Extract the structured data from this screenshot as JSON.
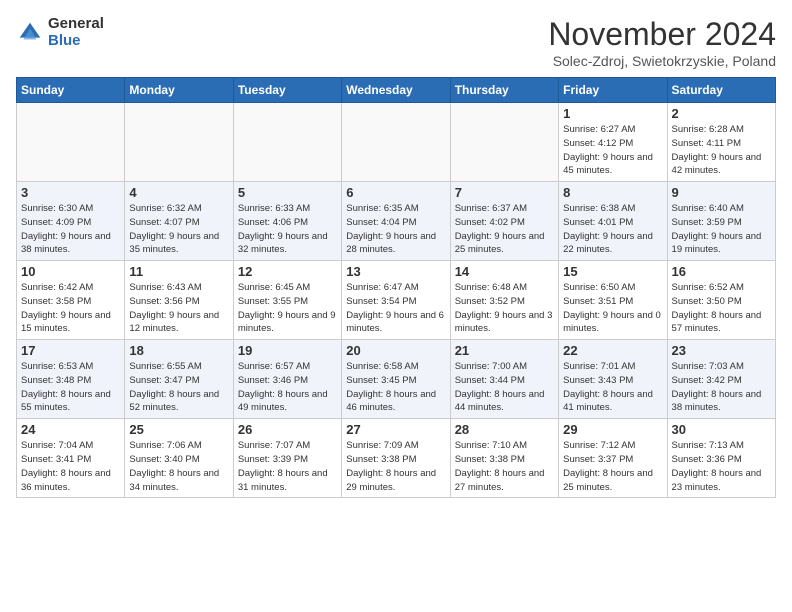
{
  "logo": {
    "general": "General",
    "blue": "Blue"
  },
  "title": "November 2024",
  "subtitle": "Solec-Zdroj, Swietokrzyskie, Poland",
  "days_of_week": [
    "Sunday",
    "Monday",
    "Tuesday",
    "Wednesday",
    "Thursday",
    "Friday",
    "Saturday"
  ],
  "weeks": [
    [
      {
        "day": "",
        "empty": true
      },
      {
        "day": "",
        "empty": true
      },
      {
        "day": "",
        "empty": true
      },
      {
        "day": "",
        "empty": true
      },
      {
        "day": "",
        "empty": true
      },
      {
        "day": "1",
        "sunrise": "6:27 AM",
        "sunset": "4:12 PM",
        "daylight": "Daylight: 9 hours and 45 minutes."
      },
      {
        "day": "2",
        "sunrise": "6:28 AM",
        "sunset": "4:11 PM",
        "daylight": "Daylight: 9 hours and 42 minutes."
      }
    ],
    [
      {
        "day": "3",
        "sunrise": "6:30 AM",
        "sunset": "4:09 PM",
        "daylight": "Daylight: 9 hours and 38 minutes."
      },
      {
        "day": "4",
        "sunrise": "6:32 AM",
        "sunset": "4:07 PM",
        "daylight": "Daylight: 9 hours and 35 minutes."
      },
      {
        "day": "5",
        "sunrise": "6:33 AM",
        "sunset": "4:06 PM",
        "daylight": "Daylight: 9 hours and 32 minutes."
      },
      {
        "day": "6",
        "sunrise": "6:35 AM",
        "sunset": "4:04 PM",
        "daylight": "Daylight: 9 hours and 28 minutes."
      },
      {
        "day": "7",
        "sunrise": "6:37 AM",
        "sunset": "4:02 PM",
        "daylight": "Daylight: 9 hours and 25 minutes."
      },
      {
        "day": "8",
        "sunrise": "6:38 AM",
        "sunset": "4:01 PM",
        "daylight": "Daylight: 9 hours and 22 minutes."
      },
      {
        "day": "9",
        "sunrise": "6:40 AM",
        "sunset": "3:59 PM",
        "daylight": "Daylight: 9 hours and 19 minutes."
      }
    ],
    [
      {
        "day": "10",
        "sunrise": "6:42 AM",
        "sunset": "3:58 PM",
        "daylight": "Daylight: 9 hours and 15 minutes."
      },
      {
        "day": "11",
        "sunrise": "6:43 AM",
        "sunset": "3:56 PM",
        "daylight": "Daylight: 9 hours and 12 minutes."
      },
      {
        "day": "12",
        "sunrise": "6:45 AM",
        "sunset": "3:55 PM",
        "daylight": "Daylight: 9 hours and 9 minutes."
      },
      {
        "day": "13",
        "sunrise": "6:47 AM",
        "sunset": "3:54 PM",
        "daylight": "Daylight: 9 hours and 6 minutes."
      },
      {
        "day": "14",
        "sunrise": "6:48 AM",
        "sunset": "3:52 PM",
        "daylight": "Daylight: 9 hours and 3 minutes."
      },
      {
        "day": "15",
        "sunrise": "6:50 AM",
        "sunset": "3:51 PM",
        "daylight": "Daylight: 9 hours and 0 minutes."
      },
      {
        "day": "16",
        "sunrise": "6:52 AM",
        "sunset": "3:50 PM",
        "daylight": "Daylight: 8 hours and 57 minutes."
      }
    ],
    [
      {
        "day": "17",
        "sunrise": "6:53 AM",
        "sunset": "3:48 PM",
        "daylight": "Daylight: 8 hours and 55 minutes."
      },
      {
        "day": "18",
        "sunrise": "6:55 AM",
        "sunset": "3:47 PM",
        "daylight": "Daylight: 8 hours and 52 minutes."
      },
      {
        "day": "19",
        "sunrise": "6:57 AM",
        "sunset": "3:46 PM",
        "daylight": "Daylight: 8 hours and 49 minutes."
      },
      {
        "day": "20",
        "sunrise": "6:58 AM",
        "sunset": "3:45 PM",
        "daylight": "Daylight: 8 hours and 46 minutes."
      },
      {
        "day": "21",
        "sunrise": "7:00 AM",
        "sunset": "3:44 PM",
        "daylight": "Daylight: 8 hours and 44 minutes."
      },
      {
        "day": "22",
        "sunrise": "7:01 AM",
        "sunset": "3:43 PM",
        "daylight": "Daylight: 8 hours and 41 minutes."
      },
      {
        "day": "23",
        "sunrise": "7:03 AM",
        "sunset": "3:42 PM",
        "daylight": "Daylight: 8 hours and 38 minutes."
      }
    ],
    [
      {
        "day": "24",
        "sunrise": "7:04 AM",
        "sunset": "3:41 PM",
        "daylight": "Daylight: 8 hours and 36 minutes."
      },
      {
        "day": "25",
        "sunrise": "7:06 AM",
        "sunset": "3:40 PM",
        "daylight": "Daylight: 8 hours and 34 minutes."
      },
      {
        "day": "26",
        "sunrise": "7:07 AM",
        "sunset": "3:39 PM",
        "daylight": "Daylight: 8 hours and 31 minutes."
      },
      {
        "day": "27",
        "sunrise": "7:09 AM",
        "sunset": "3:38 PM",
        "daylight": "Daylight: 8 hours and 29 minutes."
      },
      {
        "day": "28",
        "sunrise": "7:10 AM",
        "sunset": "3:38 PM",
        "daylight": "Daylight: 8 hours and 27 minutes."
      },
      {
        "day": "29",
        "sunrise": "7:12 AM",
        "sunset": "3:37 PM",
        "daylight": "Daylight: 8 hours and 25 minutes."
      },
      {
        "day": "30",
        "sunrise": "7:13 AM",
        "sunset": "3:36 PM",
        "daylight": "Daylight: 8 hours and 23 minutes."
      }
    ]
  ]
}
